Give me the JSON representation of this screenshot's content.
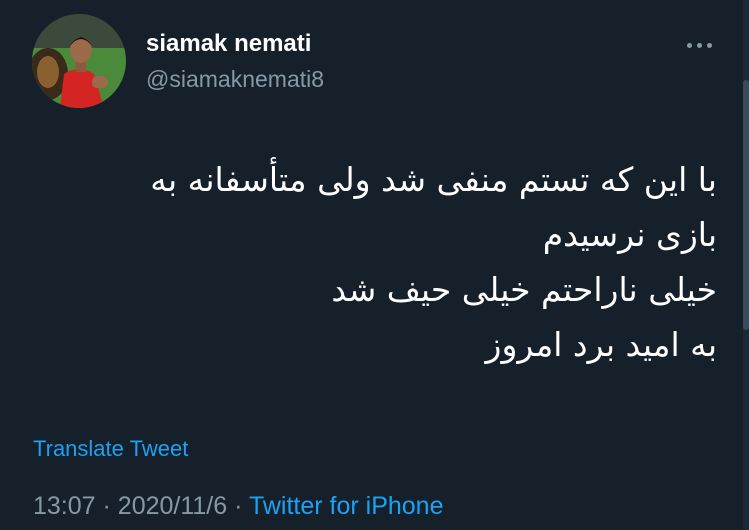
{
  "tweet": {
    "display_name": "siamak nemati",
    "handle": "@siamaknemati8",
    "text_lines": [
      "با این که تستم منفی شد ولی متأسفانه به",
      "بازی نرسیدم",
      "خیلی ناراحتم خیلی حیف شد",
      "به امید برد امروز"
    ],
    "translate_label": "Translate Tweet",
    "time": "13:07",
    "separator": "·",
    "date": "2020/11/6",
    "source": "Twitter for iPhone"
  },
  "icons": {
    "more": "more-horizontal-icon"
  },
  "colors": {
    "background": "#15202b",
    "text": "#ffffff",
    "secondary_text": "#8899a6",
    "link": "#1da1f2"
  }
}
